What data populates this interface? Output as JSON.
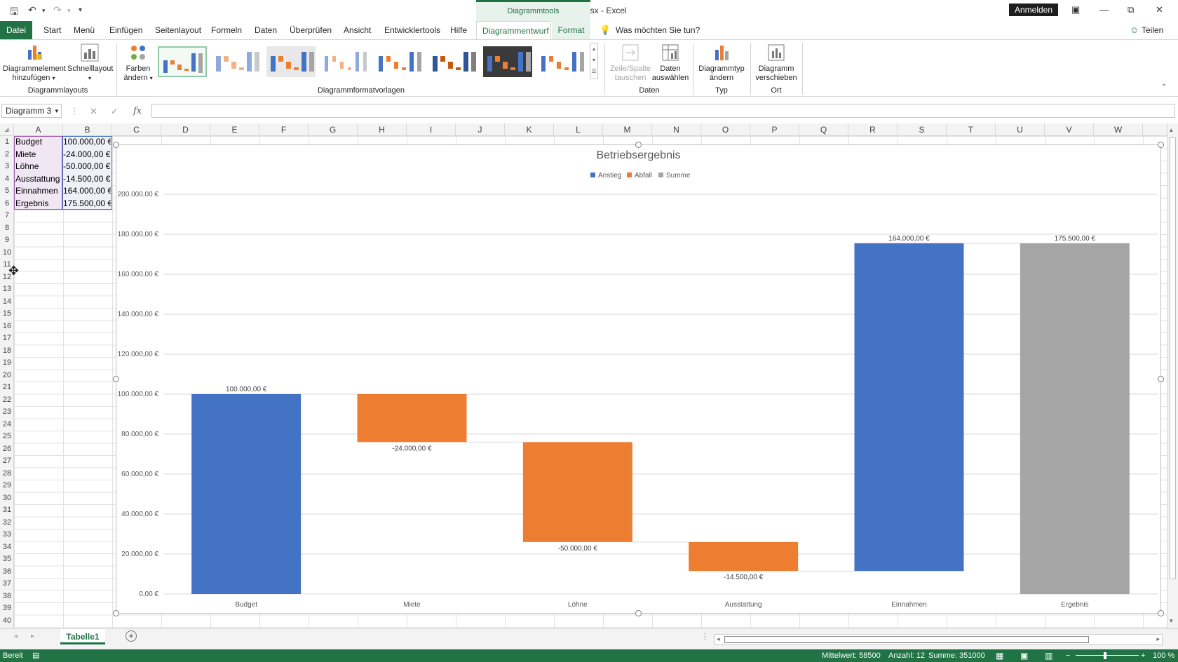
{
  "window": {
    "doc_title": "Mappe1.xlsx  -  Excel",
    "context_header": "Diagrammtools",
    "signin": "Anmelden"
  },
  "tabs": [
    "Datei",
    "Start",
    "Menü",
    "Einfügen",
    "Seitenlayout",
    "Formeln",
    "Daten",
    "Überprüfen",
    "Ansicht",
    "Entwicklertools",
    "Hilfe",
    "Diagrammentwurf",
    "Format"
  ],
  "active_tab": "Diagrammentwurf",
  "tell_me": "Was möchten Sie tun?",
  "share": "Teilen",
  "ribbon": {
    "add_element_1": "Diagrammelement",
    "add_element_2": "hinzufügen",
    "quick_layout": "Schnelllayout",
    "group_layouts": "Diagrammlayouts",
    "colors_1": "Farben",
    "colors_2": "ändern",
    "group_styles": "Diagrammformatvorlagen",
    "switch_1": "Zeile/Spalte",
    "switch_2": "tauschen",
    "select_1": "Daten",
    "select_2": "auswählen",
    "group_data": "Daten",
    "charttype_1": "Diagrammtyp",
    "charttype_2": "ändern",
    "group_type": "Typ",
    "move_1": "Diagramm",
    "move_2": "verschieben",
    "group_location": "Ort"
  },
  "formula_bar": {
    "name_box": "Diagramm 3",
    "formula": ""
  },
  "columns": [
    "A",
    "B",
    "C",
    "D",
    "E",
    "F",
    "G",
    "H",
    "I",
    "J",
    "K",
    "L",
    "M",
    "N",
    "O",
    "P",
    "Q",
    "R",
    "S",
    "T",
    "U",
    "V",
    "W"
  ],
  "rows": [
    "1",
    "2",
    "3",
    "4",
    "5",
    "6",
    "7",
    "8",
    "9",
    "10",
    "11",
    "12",
    "13",
    "14",
    "15",
    "16",
    "17",
    "18",
    "19",
    "20",
    "21",
    "22",
    "23",
    "24",
    "25",
    "26",
    "27",
    "28",
    "29",
    "30",
    "31",
    "32",
    "33",
    "34",
    "35",
    "36",
    "37",
    "38",
    "39",
    "40"
  ],
  "cells": [
    {
      "a": "Budget",
      "b": "100.000,00 €"
    },
    {
      "a": "Miete",
      "b": "-24.000,00 €"
    },
    {
      "a": "Löhne",
      "b": "-50.000,00 €"
    },
    {
      "a": "Ausstattung",
      "b": "-14.500,00 €"
    },
    {
      "a": "Einnahmen",
      "b": "164.000,00 €"
    },
    {
      "a": "Ergebnis",
      "b": "175.500,00 €"
    }
  ],
  "chart_data": {
    "type": "bar",
    "subtype": "waterfall",
    "title": "Betriebsergebnis",
    "legend_position": "top",
    "legend": [
      {
        "name": "Anstieg",
        "color": "#4472c4"
      },
      {
        "name": "Abfall",
        "color": "#ed7d31"
      },
      {
        "name": "Summe",
        "color": "#a5a5a5"
      }
    ],
    "categories": [
      "Budget",
      "Miete",
      "Löhne",
      "Ausstattung",
      "Einnahmen",
      "Ergebnis"
    ],
    "values": [
      100000,
      -24000,
      -50000,
      -14500,
      164000,
      175500
    ],
    "kind": [
      "increase",
      "decrease",
      "decrease",
      "decrease",
      "increase",
      "total"
    ],
    "bar_base": [
      0,
      76000,
      26000,
      11500,
      11500,
      0
    ],
    "bar_top": [
      100000,
      100000,
      76000,
      26000,
      175500,
      175500
    ],
    "data_labels": [
      "100.000,00 €",
      "-24.000,00 €",
      "-50.000,00 €",
      "-14.500,00 €",
      "164.000,00 €",
      "175.500,00 €"
    ],
    "y_ticks": [
      "0,00 €",
      "20.000,00 €",
      "40.000,00 €",
      "60.000,00 €",
      "80.000,00 €",
      "100.000,00 €",
      "120.000,00 €",
      "140.000,00 €",
      "160.000,00 €",
      "180.000,00 €",
      "200.000,00 €"
    ],
    "ylim": [
      0,
      200000
    ],
    "grid": true
  },
  "sheet_tab": "Tabelle1",
  "status": {
    "ready": "Bereit",
    "average": "Mittelwert: 58500",
    "count": "Anzahl: 12",
    "sum": "Summe: 351000",
    "zoom": "100 %"
  }
}
